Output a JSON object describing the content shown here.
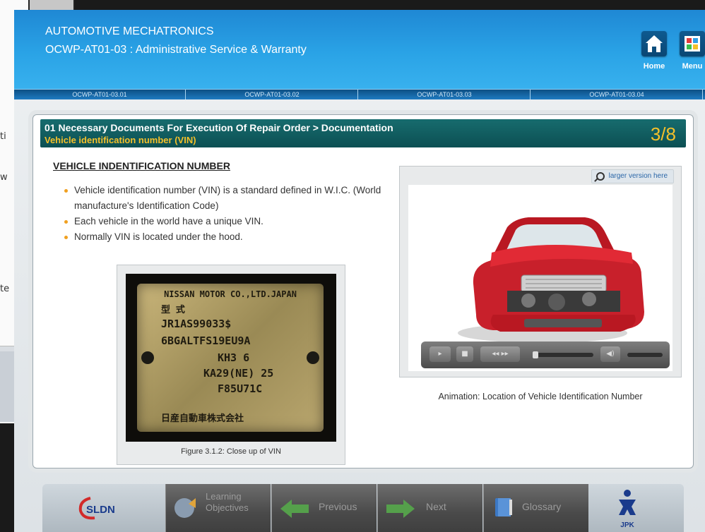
{
  "background_window": {
    "fragments": [
      "ti",
      "w",
      "te"
    ]
  },
  "header": {
    "course_title": "AUTOMOTIVE MECHATRONICS",
    "module_title": "OCWP-AT01-03 : Administrative Service & Warranty",
    "home_label": "Home",
    "menu_label": "Menu",
    "home_icon": "home-icon",
    "menu_icon": "menu-grid-icon"
  },
  "topic_tabs": [
    {
      "label": "OCWP-AT01-03.01"
    },
    {
      "label": "OCWP-AT01-03.02"
    },
    {
      "label": "OCWP-AT01-03.03"
    },
    {
      "label": "OCWP-AT01-03.04"
    }
  ],
  "content": {
    "breadcrumb": "01 Necessary Documents For Execution Of Repair Order > Documentation",
    "subtitle": "Vehicle identification number (VIN)",
    "page_indicator": "3/8",
    "section_heading": "VEHICLE INDENTIFICATION NUMBER",
    "bullets": [
      "Vehicle identification number (VIN) is a standard defined in W.I.C. (World manufacture's Identification Code)",
      "Each vehicle in the world have a unique VIN.",
      "Normally VIN is located under the hood."
    ],
    "figure_caption": "Figure 3.1.2: Close up of VIN",
    "vin_plate_lines": [
      "NISSAN MOTOR CO.,LTD.JAPAN",
      "型 式",
      "JR1AS99033$",
      "6BGALTFS19EU9A",
      "KH3 6",
      "KA29(NE) 25",
      "F85U71C",
      "日産自動車株式会社"
    ],
    "larger_version_link": "larger version here",
    "animation_caption": "Animation: Location of Vehicle Identification Number"
  },
  "player": {
    "play_icon": "play-icon",
    "stop_icon": "stop-icon",
    "step_icon": "step-icon",
    "volume_icon": "volume-icon"
  },
  "bottom_nav": {
    "logo_text": "SLDN",
    "buttons": [
      {
        "label_line1": "Learning",
        "label_line2": "Objectives"
      },
      {
        "label": "Previous"
      },
      {
        "label": "Next"
      },
      {
        "label": "Glossary"
      }
    ],
    "jpk_text": "JPK"
  },
  "colors": {
    "header_blue": "#2aa3e6",
    "title_teal": "#0f5c60",
    "accent_yellow": "#f4c02a",
    "bullet_orange": "#f0a020"
  }
}
